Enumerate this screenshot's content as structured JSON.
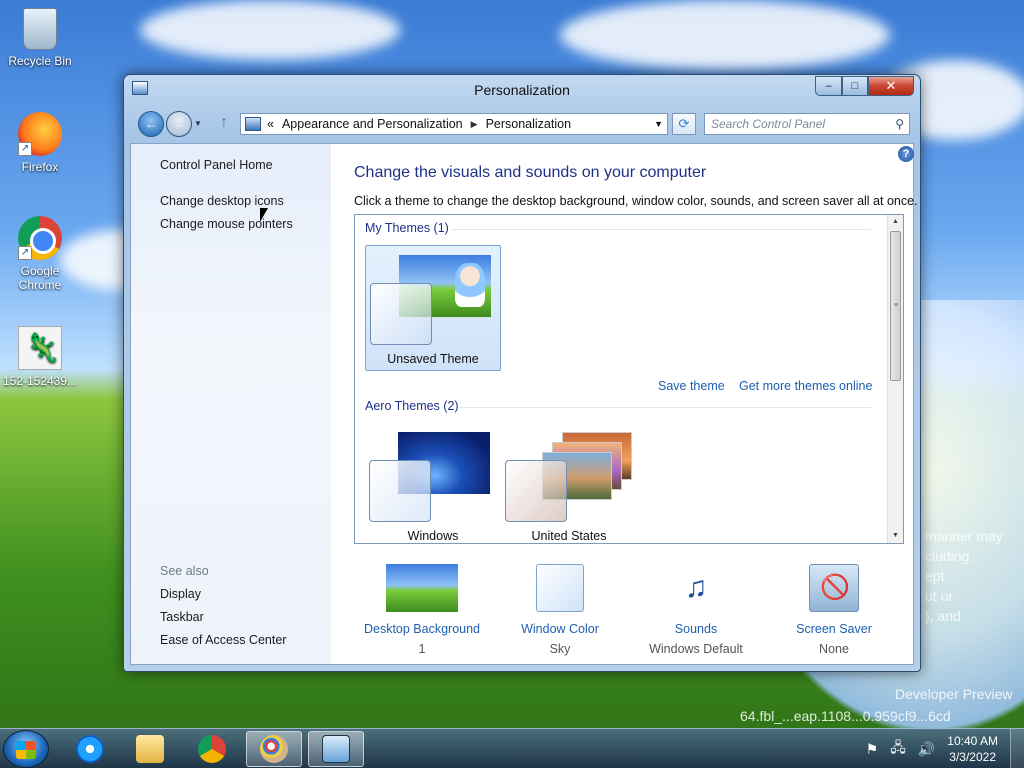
{
  "desktop": {
    "icons": [
      {
        "label": "Recycle Bin",
        "icon": "recycle-bin-icon"
      },
      {
        "label": "Firefox",
        "icon": "firefox-icon"
      },
      {
        "label": "Google Chrome",
        "icon": "chrome-icon"
      },
      {
        "label": "152-152439...",
        "icon": "image-file-icon"
      }
    ],
    "watermark": {
      "line1": "manner may",
      "line2": "cluding",
      "line3": "ept",
      "line4": "ut or",
      "line5": "), and",
      "build": "Developer Preview",
      "build2": "64.fbl_...eap.1108...0.959cf9...6cd"
    }
  },
  "window": {
    "title": "Personalization",
    "buttons": {
      "minimize": "–",
      "maximize": "□",
      "close": "✕"
    },
    "address": {
      "prefix": "«",
      "crumb1": "Appearance and Personalization",
      "crumb2": "Personalization"
    },
    "search_placeholder": "Search Control Panel",
    "left_nav": {
      "home": "Control Panel Home",
      "links": [
        "Change desktop icons",
        "Change mouse pointers"
      ],
      "see_also_title": "See also",
      "see_also": [
        "Display",
        "Taskbar",
        "Ease of Access Center"
      ]
    },
    "main": {
      "heading": "Change the visuals and sounds on your computer",
      "subtitle": "Click a theme to change the desktop background, window color, sounds, and screen saver all at once.",
      "my_themes_label": "My Themes (1)",
      "my_themes": [
        {
          "name": "Unsaved Theme",
          "selected": true
        }
      ],
      "save_theme": "Save theme",
      "get_more": "Get more themes online",
      "aero_label": "Aero Themes (2)",
      "aero_themes": [
        {
          "name": "Windows"
        },
        {
          "name": "United States"
        }
      ]
    },
    "bottom": [
      {
        "label": "Desktop Background",
        "value": "1",
        "icon": "desktop-background-icon"
      },
      {
        "label": "Window Color",
        "value": "Sky",
        "icon": "window-color-icon"
      },
      {
        "label": "Sounds",
        "value": "Windows Default",
        "icon": "sounds-icon"
      },
      {
        "label": "Screen Saver",
        "value": "None",
        "icon": "screen-saver-icon"
      }
    ]
  },
  "taskbar": {
    "clock_time": "10:40 AM",
    "clock_date": "3/3/2022"
  }
}
